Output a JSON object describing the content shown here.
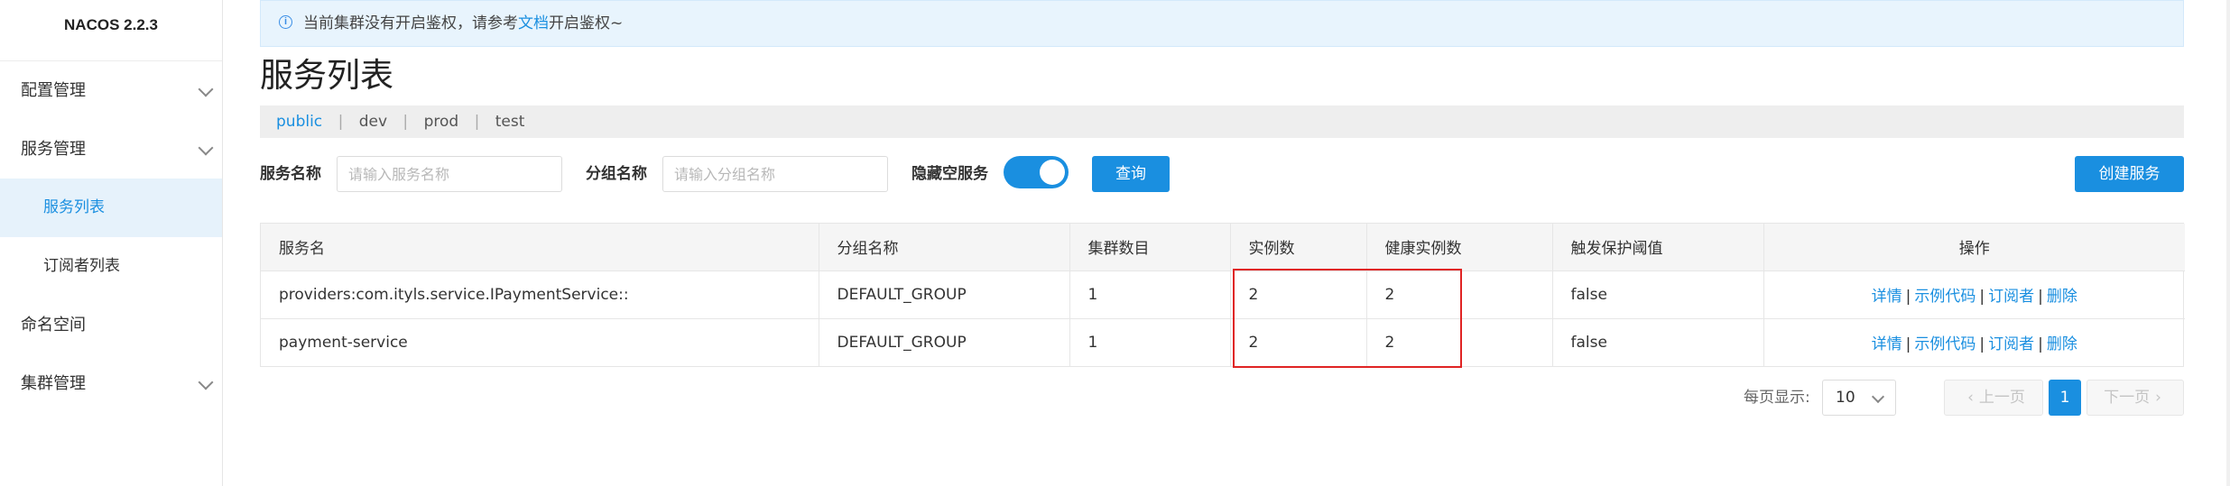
{
  "app": {
    "brand": "NACOS 2.2.3"
  },
  "sidebar": {
    "items": [
      {
        "label": "配置管理",
        "has_children": true
      },
      {
        "label": "服务管理",
        "has_children": true
      },
      {
        "label": "服务列表",
        "sub": true,
        "active": true
      },
      {
        "label": "订阅者列表",
        "sub": true
      },
      {
        "label": "命名空间",
        "has_children": false
      },
      {
        "label": "集群管理",
        "has_children": true
      }
    ]
  },
  "notice": {
    "icon": "info-icon",
    "text_before": "当前集群没有开启鉴权，请参考",
    "link": "文档",
    "text_after": "开启鉴权~"
  },
  "page": {
    "title": "服务列表"
  },
  "namespaces": [
    {
      "label": "public",
      "active": true
    },
    {
      "label": "dev"
    },
    {
      "label": "prod"
    },
    {
      "label": "test"
    }
  ],
  "filters": {
    "service_name_label": "服务名称",
    "service_name_placeholder": "请输入服务名称",
    "group_name_label": "分组名称",
    "group_name_placeholder": "请输入分组名称",
    "hide_empty_label": "隐藏空服务",
    "hide_empty_on": true,
    "query_button": "查询",
    "create_button": "创建服务"
  },
  "table": {
    "columns": [
      "服务名",
      "分组名称",
      "集群数目",
      "实例数",
      "健康实例数",
      "触发保护阈值",
      "操作"
    ],
    "rows": [
      {
        "name": "providers:com.ityls.service.IPaymentService::",
        "group": "DEFAULT_GROUP",
        "clusters": "1",
        "instances": "2",
        "healthy": "2",
        "threshold": "false"
      },
      {
        "name": "payment-service",
        "group": "DEFAULT_GROUP",
        "clusters": "1",
        "instances": "2",
        "healthy": "2",
        "threshold": "false"
      }
    ],
    "ops": [
      "详情",
      "示例代码",
      "订阅者",
      "删除"
    ],
    "ops_separator": "|"
  },
  "pagination": {
    "page_size_label": "每页显示:",
    "page_size": "10",
    "prev": "上一页",
    "next": "下一页",
    "current_page": "1"
  },
  "colors": {
    "accent": "#1a8fe0",
    "highlight": "#e02424"
  }
}
